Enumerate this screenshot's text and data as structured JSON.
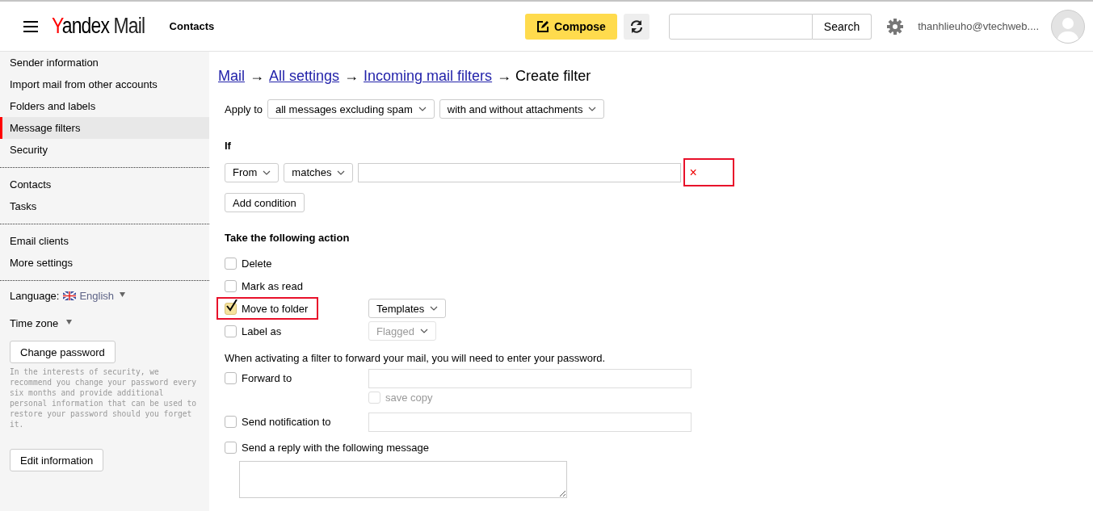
{
  "header": {
    "logo": {
      "brand": "Yandex",
      "product": "Mail"
    },
    "nav_link": "Contacts",
    "compose": "Compose",
    "search": {
      "button": "Search"
    },
    "account": "thanhlieuho@vtechweb...."
  },
  "sidebar": {
    "groups": [
      {
        "items": [
          {
            "label": "Sender information",
            "selected": false
          },
          {
            "label": "Import mail from other accounts",
            "selected": false
          },
          {
            "label": "Folders and labels",
            "selected": false
          },
          {
            "label": "Message filters",
            "selected": true
          },
          {
            "label": "Security",
            "selected": false
          }
        ]
      },
      {
        "items": [
          {
            "label": "Contacts",
            "selected": false
          },
          {
            "label": "Tasks",
            "selected": false
          }
        ]
      },
      {
        "items": [
          {
            "label": "Email clients",
            "selected": false
          },
          {
            "label": "More settings",
            "selected": false
          }
        ]
      }
    ],
    "language": {
      "label": "Language:",
      "value": "English"
    },
    "time_zone": "Time zone",
    "change_password": "Change password",
    "security_note": "In the interests of security, we recommend you change your password every six months and provide additional personal information that can be used to restore your password should you forget it.",
    "edit_information": "Edit information"
  },
  "breadcrumbs": [
    {
      "kind": "link",
      "label": "Mail"
    },
    {
      "kind": "text",
      "label": "→"
    },
    {
      "kind": "link",
      "label": "All settings"
    },
    {
      "kind": "text",
      "label": "→"
    },
    {
      "kind": "link",
      "label": "Incoming mail filters"
    },
    {
      "kind": "text",
      "label": "→ Create filter"
    }
  ],
  "apply_to": {
    "label": "Apply to",
    "selects": [
      "all messages excluding spam",
      "with and without attachments"
    ]
  },
  "condition": {
    "heading": "If",
    "field": "From",
    "operator": "matches",
    "remove": "×",
    "highlighted": true,
    "add_button": "Add condition"
  },
  "actions": {
    "heading": "Take the following action",
    "items": [
      {
        "kind": "checkbox",
        "label": "Delete",
        "checked": false,
        "highlighted": false
      },
      {
        "kind": "checkbox",
        "label": "Mark as read",
        "checked": false,
        "highlighted": false
      },
      {
        "kind": "select",
        "label": "Move to folder",
        "checked": true,
        "highlighted": true,
        "value": "Templates",
        "disabled": false
      },
      {
        "kind": "select",
        "label": "Label as",
        "checked": false,
        "highlighted": false,
        "value": "Flagged",
        "disabled": true
      }
    ]
  },
  "forward_notice": "When activating a filter to forward your mail, you will need to enter your password.",
  "forward_items": [
    {
      "kind": "field",
      "label": "Forward to",
      "checked": false,
      "sub_option": {
        "label": "save copy",
        "checked": false,
        "disabled": true
      }
    },
    {
      "kind": "field",
      "label": "Send notification to",
      "checked": false
    },
    {
      "kind": "textarea",
      "label": "Send a reply with the following message",
      "checked": false
    }
  ]
}
